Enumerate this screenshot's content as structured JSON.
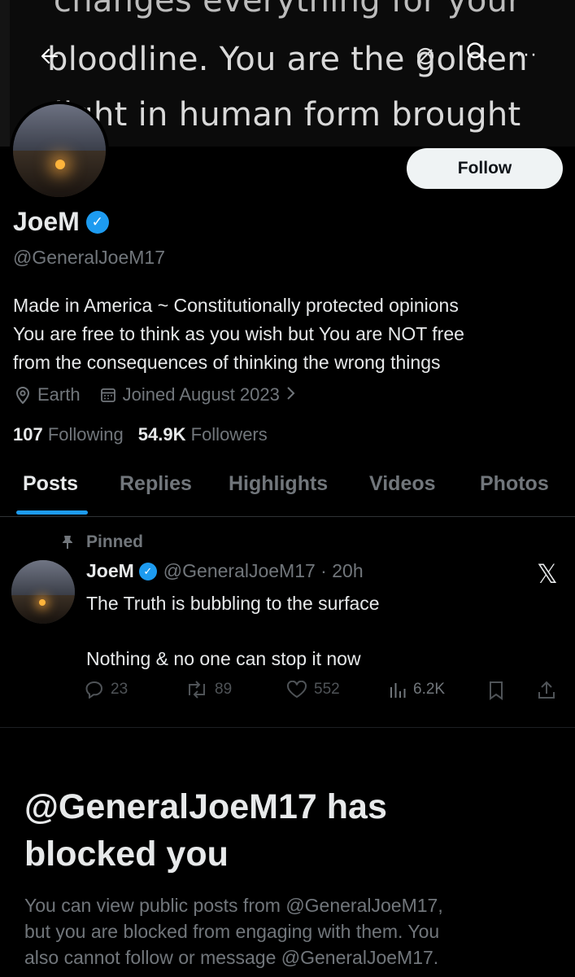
{
  "banner": {
    "lines": [
      "changes everything for your",
      "bloodline. You are the golden",
      "light in human form brought"
    ]
  },
  "top_bar": {
    "back_icon": "arrow-left-icon",
    "translate_icon": "translate-icon",
    "search_icon": "search-icon",
    "more_icon": "more-horizontal-icon",
    "more_glyph": "···"
  },
  "profile": {
    "display_name": "JoeM",
    "handle": "@GeneralJoeM17",
    "verified_color": "#1d9bf0",
    "follow_label": "Follow",
    "bio_lines": [
      "Made in America ~ Constitutionally protected opinions",
      "You are free to think as you wish but You are NOT free",
      "from the consequences of thinking the wrong things"
    ],
    "location": "Earth",
    "joined": "Joined August 2023",
    "following_count": "107",
    "following_label": "Following",
    "followers_count": "54.9K",
    "followers_label": "Followers"
  },
  "tabs": [
    {
      "label": "Posts",
      "active": true
    },
    {
      "label": "Replies"
    },
    {
      "label": "Highlights"
    },
    {
      "label": "Videos"
    },
    {
      "label": "Photos"
    }
  ],
  "pinned_post": {
    "pinned_label": "Pinned",
    "author_name": "JoeM",
    "author_handle_time": "@GeneralJoeM17 · 20h",
    "text_line1": "The Truth is bubbling to the surface",
    "text_line2": "Nothing & no one can stop it now",
    "replies": "23",
    "reposts": "89",
    "likes": "552",
    "views": "6.2K"
  },
  "blocked": {
    "title_line1": "@GeneralJoeM17 has",
    "title_line2": "blocked you",
    "desc_lines": [
      "You can view public posts from @GeneralJoeM17,",
      "but you are blocked from engaging with them. You",
      "also cannot follow or message @GeneralJoeM17."
    ]
  },
  "colors": {
    "background": "#000000",
    "text_primary": "#e7e9ea",
    "text_secondary": "#71767b",
    "accent": "#1d9bf0"
  }
}
